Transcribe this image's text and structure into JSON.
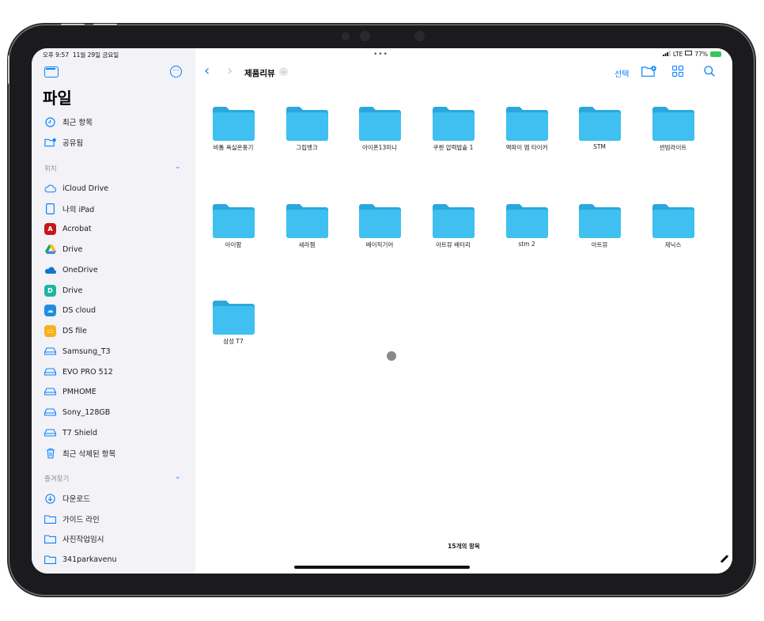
{
  "status": {
    "time": "오후 9:57",
    "date": "11월 29일 금요일",
    "right": "LTE",
    "battery": "77%",
    "multitask_dots": "•••"
  },
  "sidebar": {
    "title": "파일",
    "top_items": [
      {
        "label": "최근 항목",
        "icon": "clock-icon"
      },
      {
        "label": "공유됨",
        "icon": "shared-folder-icon"
      }
    ],
    "locations_header": "위치",
    "locations": [
      {
        "label": "iCloud Drive",
        "icon": "cloud-icon"
      },
      {
        "label": "나의 iPad",
        "icon": "ipad-icon"
      },
      {
        "label": "Acrobat",
        "icon": "acrobat-icon",
        "color": "#c4161c"
      },
      {
        "label": "Drive",
        "icon": "google-drive-icon"
      },
      {
        "label": "OneDrive",
        "icon": "onedrive-icon"
      },
      {
        "label": "Drive",
        "icon": "drive-app-icon",
        "color": "#1fb5a5"
      },
      {
        "label": "DS cloud",
        "icon": "ds-cloud-icon",
        "color": "#1d8fe1"
      },
      {
        "label": "DS file",
        "icon": "ds-file-icon",
        "color": "#f7b21b"
      },
      {
        "label": "Samsung_T3",
        "icon": "drive-disk-icon"
      },
      {
        "label": "EVO PRO 512",
        "icon": "drive-disk-icon"
      },
      {
        "label": "PMHOME",
        "icon": "drive-disk-icon"
      },
      {
        "label": "Sony_128GB",
        "icon": "drive-disk-icon"
      },
      {
        "label": "T7 Shield",
        "icon": "drive-disk-icon"
      },
      {
        "label": "최근 삭제된 항목",
        "icon": "trash-icon"
      }
    ],
    "favorites_header": "즐겨찾기",
    "favorites": [
      {
        "label": "다운로드",
        "icon": "download-icon"
      },
      {
        "label": "가이드 라인",
        "icon": "folder-icon"
      },
      {
        "label": "사진작업임시",
        "icon": "folder-icon"
      },
      {
        "label": "341parkavenu",
        "icon": "folder-icon"
      }
    ]
  },
  "toolbar": {
    "folder_title": "제품리뷰",
    "select_label": "선택"
  },
  "folders": [
    "바톰 욕실온풍기",
    "그립뱅크",
    "아이폰13미니",
    "쿠첸 압력밥솥 1",
    "맥파이 엠 타이커",
    "STM",
    "썬빔라이트",
    "아이팜",
    "세라젬",
    "베이직기어",
    "아트뮤 배터리",
    "stm 2",
    "아트뮤",
    "제닉스",
    "삼성 T7"
  ],
  "footer": {
    "count_label": "15개의 항목"
  },
  "colors": {
    "accent": "#0a84ff",
    "folder": "#3fc0f0",
    "folder_dark": "#2aa8de"
  }
}
